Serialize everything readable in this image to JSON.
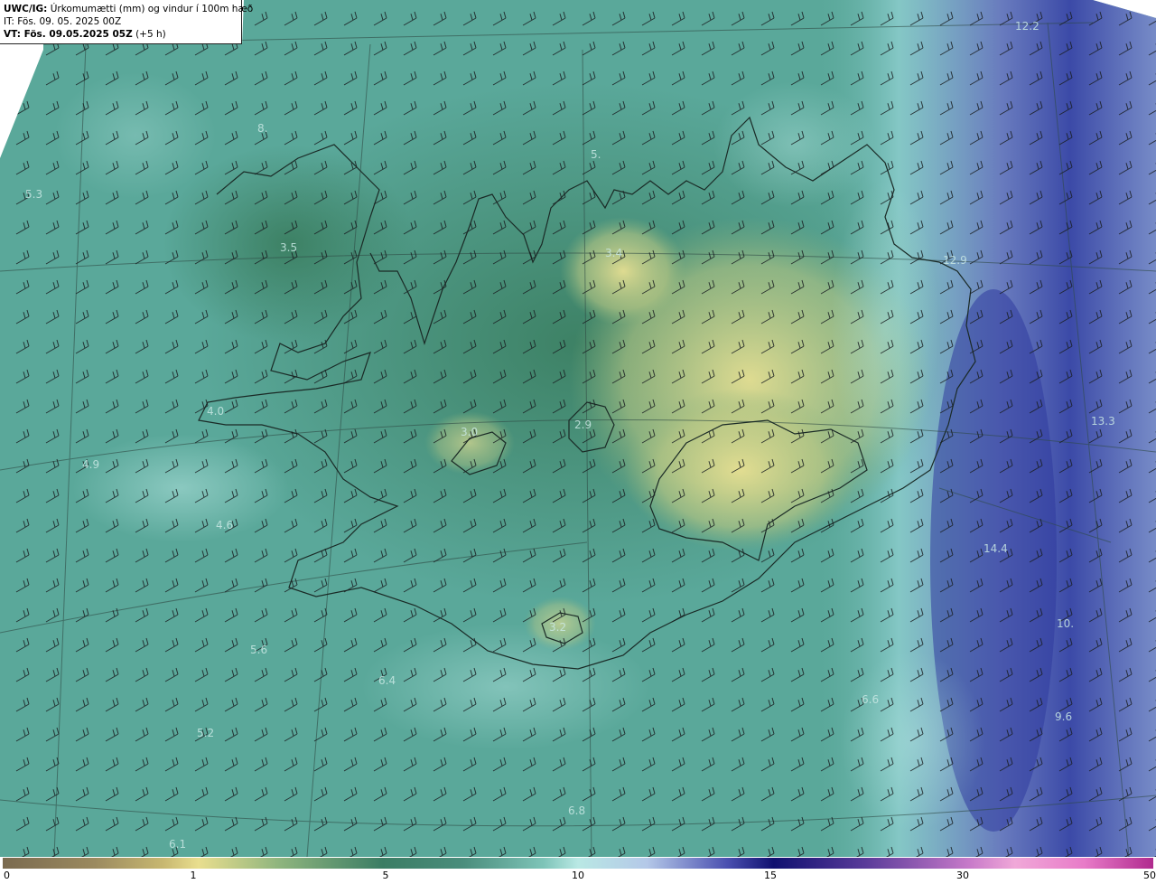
{
  "header": {
    "title_bold": "UWC/IG:",
    "title_text": "Úrkomumætti (mm) og vindur í 100m hæð",
    "issue_time": "IT: Fös. 09. 05. 2025 00Z",
    "valid_label": "VT: Fös. 09.05.2025 05Z",
    "valid_offset": "(+5 h)"
  },
  "value_labels": [
    "12.2",
    "5.3",
    "3.5",
    "3.4",
    "12.9",
    "4.0",
    "3.0",
    "2.9",
    "13.3",
    "4.9",
    "4.6",
    "14.4",
    "3.2",
    "5.6",
    "6.4",
    "6.6",
    "5.2",
    "6.8",
    "6.1",
    "10.",
    "9.6",
    "8.",
    "5."
  ],
  "colorbar": {
    "ticks": [
      "0",
      "1",
      "5",
      "10",
      "15",
      "30",
      "50"
    ]
  },
  "colors": {
    "sea_teal": "#5aa89a",
    "land_dark_green": "#3b7d64",
    "land_yellow": "#dcd98a",
    "deep_blue": "#3a45a8",
    "light_cyan": "#b9e8e4"
  }
}
